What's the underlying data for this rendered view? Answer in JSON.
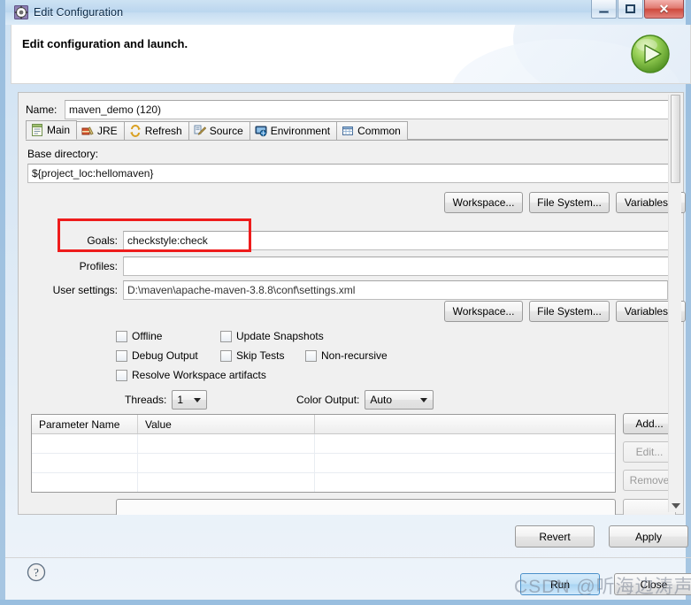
{
  "window": {
    "title": "Edit Configuration",
    "icon": "gear-icon",
    "minimize_label": "",
    "maximize_label": "",
    "close_label": "✕"
  },
  "header": {
    "title": "Edit configuration and launch.",
    "run_icon": "green-run-play-icon"
  },
  "name_field": {
    "label": "Name:",
    "value": "maven_demo (120)"
  },
  "tabs": [
    {
      "label": "Main",
      "icon": "main-tab-icon",
      "active": true
    },
    {
      "label": "JRE",
      "icon": "jre-tab-icon",
      "active": false
    },
    {
      "label": "Refresh",
      "icon": "refresh-tab-icon",
      "active": false
    },
    {
      "label": "Source",
      "icon": "source-tab-icon",
      "active": false
    },
    {
      "label": "Environment",
      "icon": "environment-tab-icon",
      "active": false
    },
    {
      "label": "Common",
      "icon": "common-tab-icon",
      "active": false
    }
  ],
  "main_tab": {
    "base_directory": {
      "label": "Base directory:",
      "value": "${project_loc:hellomaven}"
    },
    "dir_buttons": [
      {
        "label": "Workspace..."
      },
      {
        "label": "File System..."
      },
      {
        "label": "Variables..."
      }
    ],
    "goals": {
      "label": "Goals:",
      "value": "checkstyle:check"
    },
    "profiles": {
      "label": "Profiles:",
      "value": ""
    },
    "user_settings": {
      "label": "User settings:",
      "value": "D:\\maven\\apache-maven-3.8.8\\conf\\settings.xml"
    },
    "settings_buttons": [
      {
        "label": "Workspace..."
      },
      {
        "label": "File System..."
      },
      {
        "label": "Variables..."
      }
    ],
    "checkboxes": [
      {
        "label": "Offline",
        "checked": false
      },
      {
        "label": "Update Snapshots",
        "checked": false
      },
      {
        "label": "Debug Output",
        "checked": false
      },
      {
        "label": "Skip Tests",
        "checked": false
      },
      {
        "label": "Non-recursive",
        "checked": false
      },
      {
        "label": "Resolve Workspace artifacts",
        "checked": false
      }
    ],
    "threads": {
      "label": "Threads:",
      "value": "1"
    },
    "color_output": {
      "label": "Color Output:",
      "value": "Auto"
    },
    "parameters_table": {
      "columns": [
        "Parameter Name",
        "Value",
        ""
      ],
      "rows": []
    },
    "table_buttons": [
      {
        "label": "Add...",
        "enabled": true
      },
      {
        "label": "Edit...",
        "enabled": false
      },
      {
        "label": "Remove",
        "enabled": false
      }
    ]
  },
  "footer": {
    "revert_label": "Revert",
    "apply_label": "Apply",
    "run_label": "Run",
    "close_label": "Close",
    "help_icon": "help-question-icon"
  },
  "annotation": {
    "color": "#ee1c1c",
    "target": "goals-field"
  },
  "watermark": {
    "text": "CSDN @听海边涛声"
  }
}
